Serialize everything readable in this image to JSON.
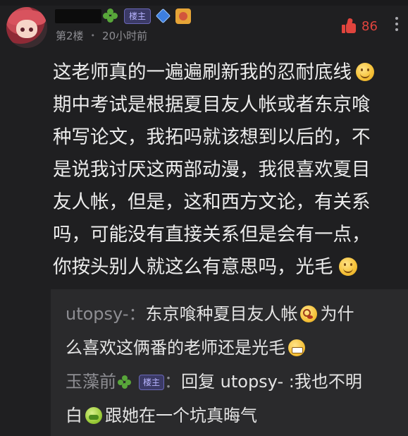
{
  "comment": {
    "author_badge": "楼主",
    "floor": "第2楼",
    "separator": "•",
    "time": "20小时前",
    "likes": "86",
    "body_lines": [
      "这老师真的一遍遍刷新我的忍耐底线",
      "期中考试是根据夏目友人帐或者东京喰",
      "种写论文，我拓吗就该想到以后的，不",
      "是说我讨厌这两部动漫，我很喜欢夏目",
      "友人帐，但是，这和西方文论，有关系",
      "吗，可能没有直接关系但是会有一点，",
      "你按头别人就这么有意思吗，光毛"
    ]
  },
  "replies": [
    {
      "author": "utopsy-",
      "colon": "：",
      "line1": "东京喰种夏目友人帐",
      "line1_after": "为什",
      "line2": "么喜欢这俩番的老师还是光毛"
    },
    {
      "author": "玉藻前",
      "badge": "楼主",
      "colon": "：",
      "line1": "回复 utopsy- :我也不明",
      "line2_a": "白",
      "line2_b": "跟她在一个坑真晦气"
    }
  ],
  "colors": {
    "background": "#1f1f21",
    "like_red": "#e0443d",
    "badge_purple": "#b8b4ff",
    "meta_gray": "#8e8e93"
  }
}
